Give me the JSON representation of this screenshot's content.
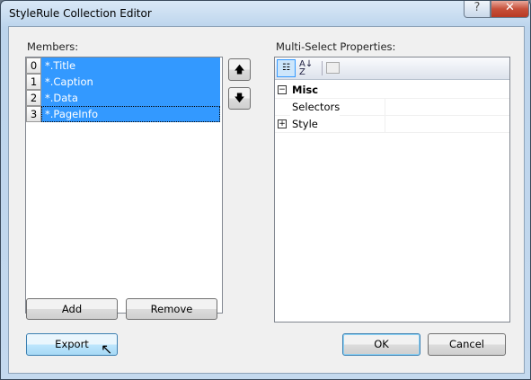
{
  "window": {
    "title": "StyleRule Collection Editor",
    "help": "?",
    "close": "✕"
  },
  "members": {
    "label": "Members:",
    "items": [
      {
        "index": "0",
        "name": "*.Title"
      },
      {
        "index": "1",
        "name": "*.Caption"
      },
      {
        "index": "2",
        "name": "*.Data"
      },
      {
        "index": "3",
        "name": "*.PageInfo"
      }
    ],
    "up": "🡅",
    "down": "🡇"
  },
  "buttons": {
    "add": "Add",
    "remove": "Remove",
    "export": "Export",
    "ok": "OK",
    "cancel": "Cancel"
  },
  "properties": {
    "label": "Multi-Select Properties:",
    "category": "Misc",
    "rows": [
      {
        "name": "Selectors",
        "value": ""
      },
      {
        "name": "Style",
        "value": ""
      }
    ],
    "minus": "−",
    "plus": "+"
  }
}
